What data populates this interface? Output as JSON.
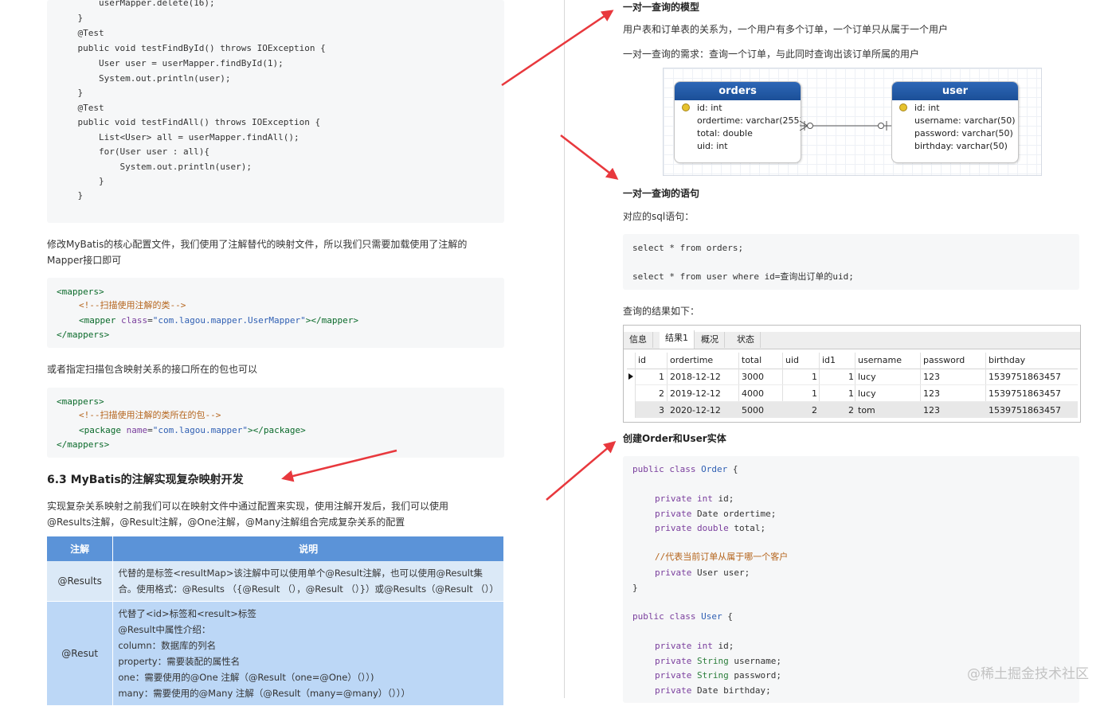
{
  "left": {
    "code1": [
      "        userMapper.delete(16);",
      "    }",
      "    @Test",
      "    public void testFindById() throws IOException {",
      "        User user = userMapper.findById(1);",
      "        System.out.println(user);",
      "    }",
      "    @Test",
      "    public void testFindAll() throws IOException {",
      "        List<User> all = userMapper.findAll();",
      "        for(User user : all){",
      "            System.out.println(user);",
      "        }",
      "    }"
    ],
    "para1_l1": "修改MyBatis的核心配置文件，我们使用了注解替代的映射文件，所以我们只需要加载使用了注解的",
    "para1_l2": "Mapper接口即可",
    "code2": {
      "open": "<mappers>",
      "comment": "<!--扫描使用注解的类-->",
      "mapper_open": "<mapper ",
      "mapper_attr": "class",
      "mapper_eq": "=",
      "mapper_val": "\"com.lagou.mapper.UserMapper\"",
      "mapper_close": "></mapper>",
      "close": "</mappers>"
    },
    "para2": "或者指定扫描包含映射关系的接口所在的包也可以",
    "code3": {
      "open": "<mappers>",
      "comment": "<!--扫描使用注解的类所在的包-->",
      "pkg_open": "<package ",
      "pkg_attr": "name",
      "pkg_eq": "=",
      "pkg_val": "\"com.lagou.mapper\"",
      "pkg_close": "></package>",
      "close": "</mappers>"
    },
    "heading": "6.3 MyBatis的注解实现复杂映射开发",
    "para3_l1": "实现复杂关系映射之前我们可以在映射文件中通过配置来实现，使用注解开发后，我们可以使用",
    "para3_l2": "@Results注解，@Result注解，@One注解，@Many注解组合完成复杂关系的配置",
    "table": {
      "headers": [
        "注解",
        "说明"
      ],
      "rows": [
        {
          "name": "@Results",
          "lines": [
            "代替的是标签<resultMap>该注解中可以使用单个@Result注解，也可以使用@Result集",
            "合。使用格式：@Results （{@Result （），@Result （）}）或@Results（@Result （））"
          ]
        },
        {
          "name": "@Resut",
          "lines": [
            "代替了<id>标签和<result>标签",
            "@Result中属性介绍：",
            "column：数据库的列名",
            "property：需要装配的属性名",
            "one：需要使用的@One 注解（@Result（one=@One）（））)",
            "many：需要使用的@Many 注解（@Result（many=@many）（）））"
          ]
        }
      ]
    }
  },
  "right": {
    "h_model": "一对一查询的模型",
    "p_relation": "用户表和订单表的关系为，一个用户有多个订单，一个订单只从属于一个用户",
    "p_require": "一对一查询的需求：查询一个订单，与此同时查询出该订单所属的用户",
    "er": {
      "orders": {
        "title": "orders",
        "fields": [
          "id: int",
          "ordertime: varchar(255)",
          "total: double",
          "uid: int"
        ]
      },
      "user": {
        "title": "user",
        "fields": [
          "id: int",
          "username: varchar(50)",
          "password: varchar(50)",
          "birthday: varchar(50)"
        ]
      }
    },
    "h_sql": "一对一查询的语句",
    "p_sql": "对应的sql语句：",
    "sql1": "select * from orders;",
    "sql2": "select * from user where id=查询出订单的uid;",
    "p_result": "查询的结果如下：",
    "grid": {
      "tabs": [
        "信息",
        "结果1",
        "概况",
        "状态"
      ],
      "columns": [
        "id",
        "ordertime",
        "total",
        "uid",
        "id1",
        "username",
        "password",
        "birthday"
      ],
      "rows": [
        [
          "1",
          "2018-12-12",
          "3000",
          "1",
          "1",
          "lucy",
          "123",
          "1539751863457"
        ],
        [
          "2",
          "2019-12-12",
          "4000",
          "1",
          "1",
          "lucy",
          "123",
          "1539751863457"
        ],
        [
          "3",
          "2020-12-12",
          "5000",
          "2",
          "2",
          "tom",
          "123",
          "1539751863457"
        ]
      ]
    },
    "h_entity": "创建Order和User实体",
    "code_entity": {
      "l1_kw": "public class ",
      "l1_name": "Order",
      "l1_rest": " {",
      "f1_kw": "private ",
      "f1_type": "int",
      "f1_rest": " id;",
      "f2_kw": "private ",
      "f2_rest": "Date ordertime;",
      "f3_kw": "private ",
      "f3_type": "double",
      "f3_rest": " total;",
      "comment": "//代表当前订单从属于哪一个客户",
      "f4_kw": "private ",
      "f4_rest": "User user;",
      "close": "}",
      "l2_kw": "public class ",
      "l2_name": "User",
      "l2_rest": " {",
      "g1_kw": "private ",
      "g1_type": "int",
      "g1_rest": " id;",
      "g2_kw": "private ",
      "g2_type": "String",
      "g2_rest": " username;",
      "g3_kw": "private ",
      "g3_type": "String",
      "g3_rest": " password;",
      "g4_kw": "private ",
      "g4_rest": "Date birthday;"
    }
  },
  "watermark": "@稀土掘金技术社区",
  "colors": {
    "arrow": "#e8383d",
    "table_header": "#5b93d8",
    "table_row1": "#dbe9f7",
    "table_row2": "#bcd7f6",
    "er_header": "#1f5aa8"
  }
}
